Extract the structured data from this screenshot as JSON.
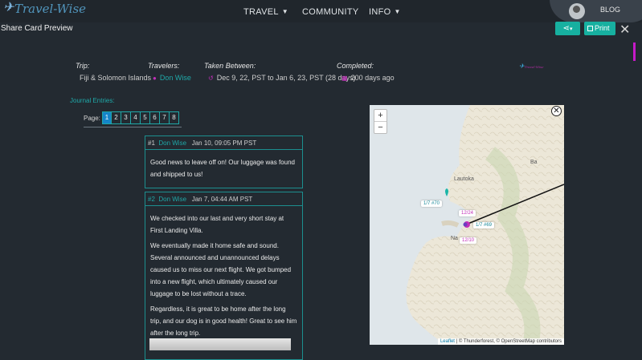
{
  "brand": {
    "logo_text": "Travel-Wise"
  },
  "nav": {
    "travel": "TRAVEL",
    "community": "COMMUNITY",
    "info": "INFO",
    "blog": "BLOG"
  },
  "modal": {
    "title": "Share Card Preview",
    "print_label": "Print",
    "close_symbol": "✕"
  },
  "trip": {
    "trip_label": "Trip:",
    "trip_value": "Fiji & Solomon Islands",
    "travelers_label": "Travelers:",
    "traveler_name": "Don Wise",
    "between_label": "Taken Between:",
    "between_value": "Dec 9, 22, PST to Jan 6, 23, PST (28 days)",
    "completed_label": "Completed:",
    "completed_value": "200 days ago"
  },
  "journal": {
    "label": "Journal Entries:",
    "page_label": "Page:",
    "pages": [
      "1",
      "2",
      "3",
      "4",
      "5",
      "6",
      "7",
      "8"
    ],
    "current_page": "1"
  },
  "entries": [
    {
      "num": "#1",
      "author": "Don Wise",
      "date": "Jan 10, 09:05 PM PST",
      "paragraphs": [
        "Good news to leave off on! Our luggage was found and shipped to us!"
      ]
    },
    {
      "num": "#2",
      "author": "Don Wise",
      "date": "Jan 7, 04:44 AM PST",
      "paragraphs": [
        "We checked into our last and very short stay at First Landing Villa.",
        "We eventually made it home safe and sound. Several announced and unannounced delays caused us to miss our next flight. We got bumped into a new flight, which ultimately caused our luggage to be lost without a trace.",
        "Regardless, it is great to be home after the long trip, and our dog is in good health! Great to see him after the long trip."
      ]
    }
  ],
  "map": {
    "zoom_in": "+",
    "zoom_out": "−",
    "close": "✕",
    "place_lautoka": "Lautoka",
    "place_ba": "Ba",
    "place_na": "Na",
    "marker_70": "1/7 #70",
    "marker_69": "1/7 #69",
    "marker_1224": "12/24",
    "marker_1210": "12/10",
    "attrib_leaflet": "Leaflet",
    "attrib_rest": "| © Thunderforest, © OpenStreetMap contributors",
    "colors": {
      "water": "#dfe6ea",
      "land": "#ece7d8",
      "route": "#111111",
      "pin_teal": "#1ab5a8",
      "pin_pink": "#c22fb9"
    }
  }
}
